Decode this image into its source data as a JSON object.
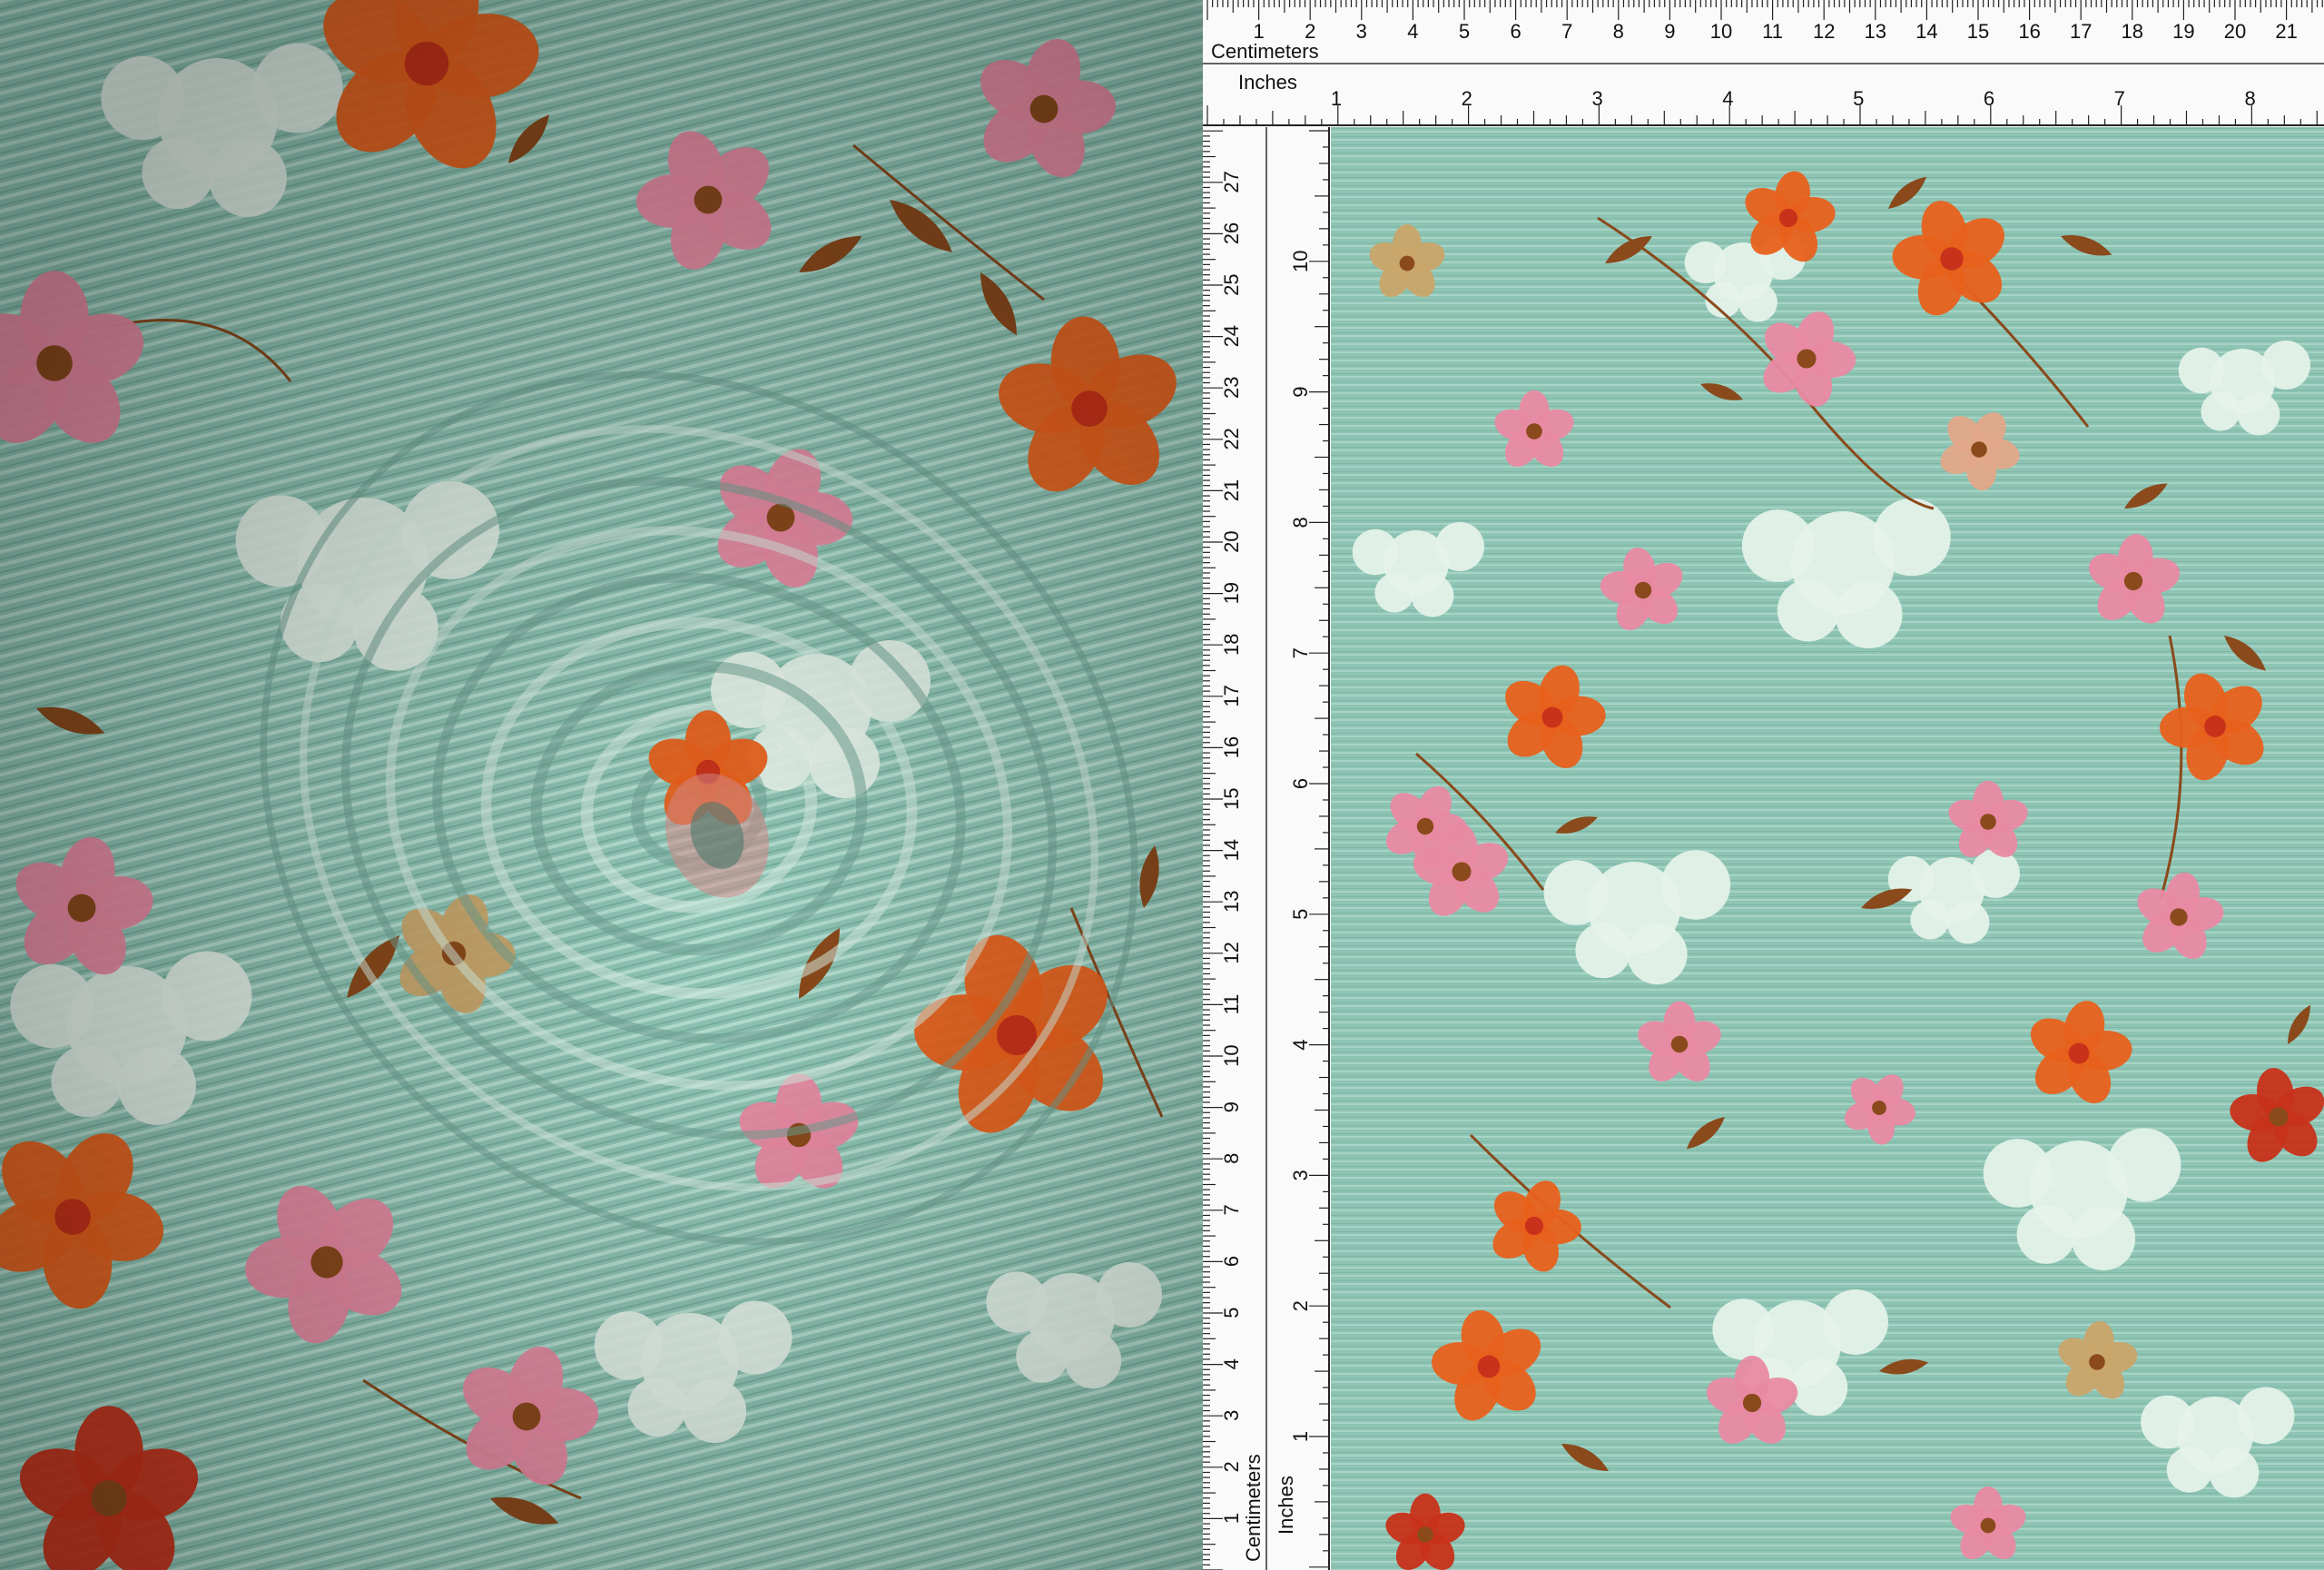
{
  "ruler_top": {
    "centimeters_label": "Centimeters",
    "inches_label": "Inches",
    "cm_numbers": [
      "1",
      "2",
      "3",
      "4",
      "5",
      "6",
      "7",
      "8",
      "9",
      "10",
      "11",
      "12",
      "13",
      "14",
      "15",
      "16",
      "17",
      "18",
      "19",
      "20",
      "21"
    ],
    "inch_numbers": [
      "1",
      "2",
      "3",
      "4",
      "5",
      "6",
      "7",
      "8"
    ]
  },
  "ruler_left": {
    "centimeters_label": "Centimeters",
    "inches_label": "Inches",
    "cm_numbers": [
      "1",
      "2",
      "3",
      "4",
      "5",
      "6",
      "7",
      "8",
      "9",
      "10",
      "11",
      "12",
      "13",
      "14",
      "15",
      "16",
      "17",
      "18",
      "19",
      "20",
      "21",
      "22",
      "23",
      "24",
      "25",
      "26",
      "27",
      "2"
    ],
    "inch_numbers": [
      "1",
      "2",
      "3",
      "4",
      "5",
      "6",
      "7",
      "8",
      "9",
      "10"
    ]
  },
  "colors": {
    "fabric_base": "#8fc4b4",
    "fabric_light": "#a9d6c8",
    "flower_orange": "#e8611c",
    "flower_red": "#c8321a",
    "flower_pink": "#e98aa3",
    "leaf_brown": "#8a4a1c",
    "leaf_tan": "#c9a56a",
    "white_silhouette": "#e6f3ea",
    "ruler_bg": "#fafafa"
  }
}
